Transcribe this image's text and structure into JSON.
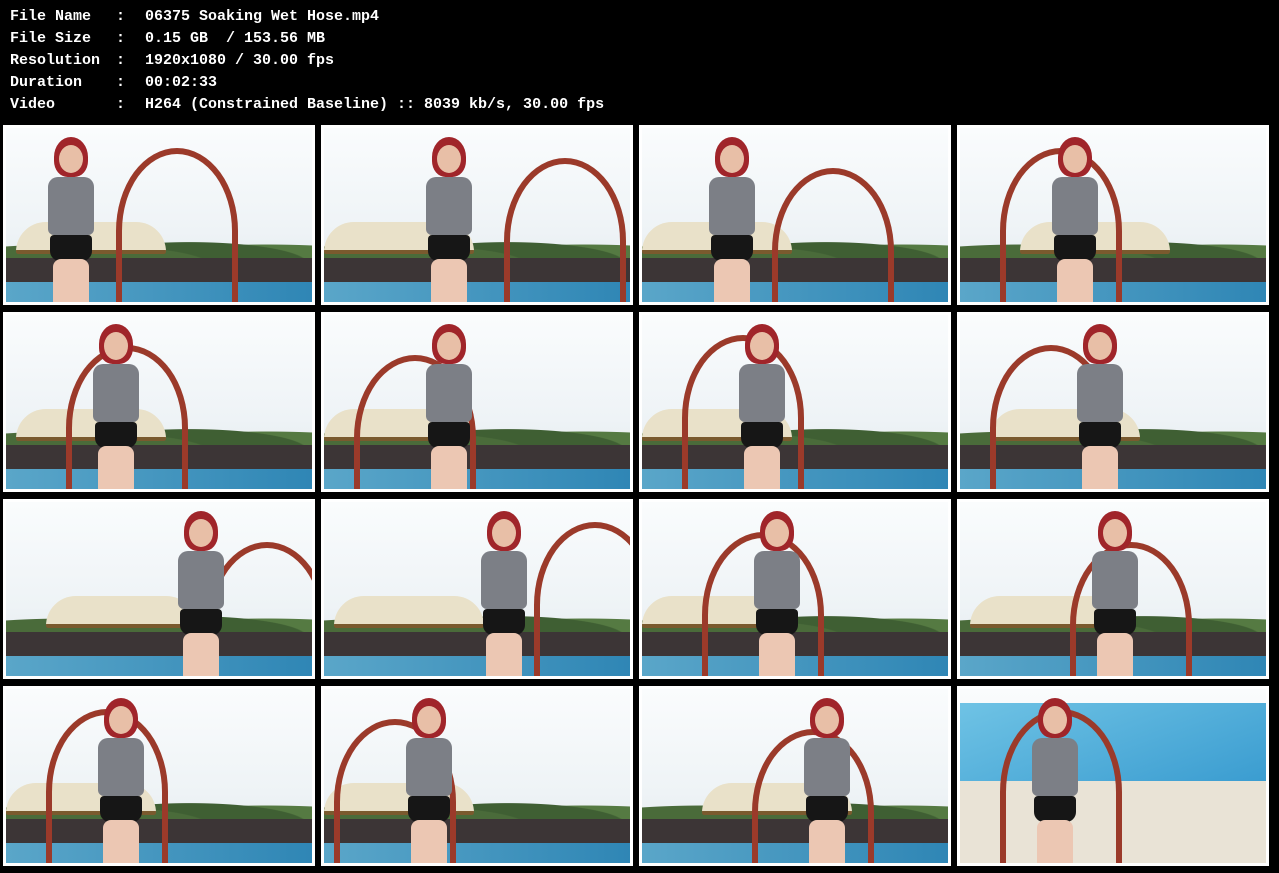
{
  "info": {
    "rows": [
      {
        "key": "File Name",
        "sep": ":",
        "value": "06375 Soaking Wet Hose.mp4"
      },
      {
        "key": "File Size",
        "sep": ":",
        "value": "0.15 GB  / 153.56 MB"
      },
      {
        "key": "Resolution",
        "sep": ":",
        "value": "1920x1080 / 30.00 fps"
      },
      {
        "key": "Duration",
        "sep": ":",
        "value": "00:02:33"
      },
      {
        "key": "Video",
        "sep": ":",
        "value": "H264 (Constrained Baseline) :: 8039 kb/s, 30.00 fps"
      }
    ]
  },
  "thumbnails": [
    {
      "scene": "pool"
    },
    {
      "scene": "pool"
    },
    {
      "scene": "pool"
    },
    {
      "scene": "pool"
    },
    {
      "scene": "pool"
    },
    {
      "scene": "pool"
    },
    {
      "scene": "pool"
    },
    {
      "scene": "pool"
    },
    {
      "scene": "pool"
    },
    {
      "scene": "pool"
    },
    {
      "scene": "pool"
    },
    {
      "scene": "pool"
    },
    {
      "scene": "pool"
    },
    {
      "scene": "pool"
    },
    {
      "scene": "pool"
    },
    {
      "scene": "beach"
    }
  ]
}
